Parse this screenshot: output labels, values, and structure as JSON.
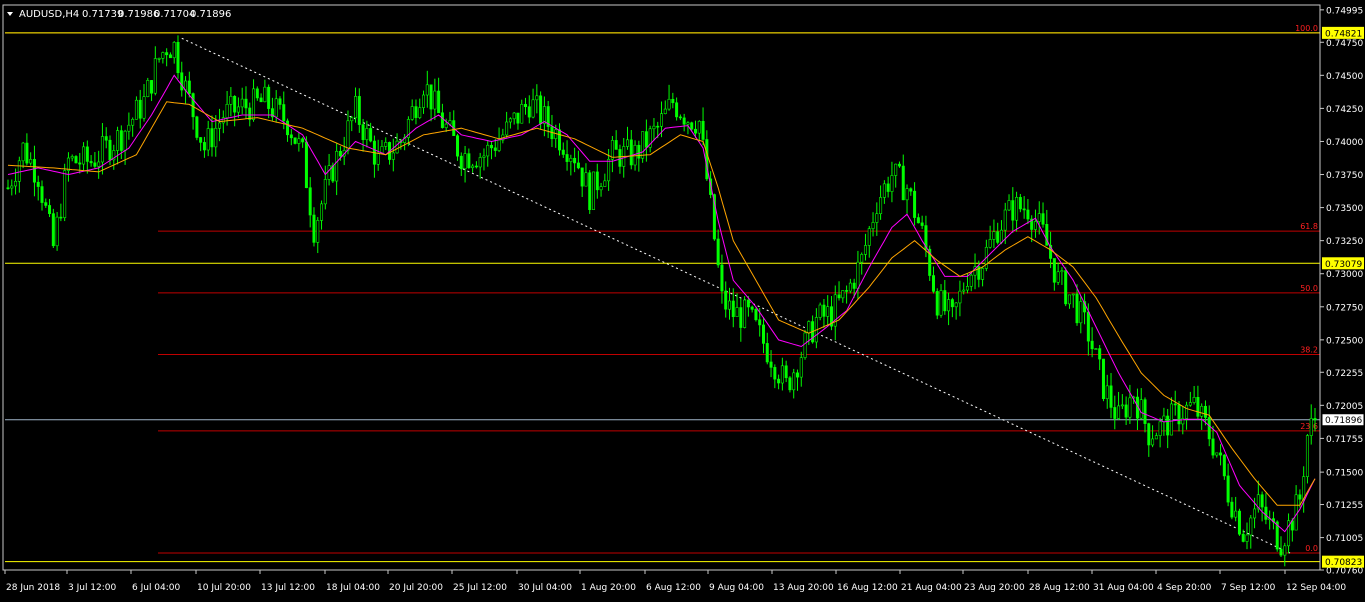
{
  "header": {
    "symbol": "AUDUSD,H4",
    "open": "0.71739",
    "high": "0.71986",
    "low": "0.71704",
    "close": "0.71896"
  },
  "colors": {
    "background": "#000000",
    "candle": "#00ff00",
    "ma_fast": "#ff00ff",
    "ma_slow": "#ffa500",
    "fib": "#c00000",
    "trendline": "#ffffff",
    "hline": "#ffff00",
    "bid_line": "#a0b4c8",
    "axis_text": "#ffffff"
  },
  "chart_data": {
    "type": "candlestick",
    "title": "AUDUSD,H4",
    "xlabel": "",
    "ylabel": "",
    "ylim": [
      0.7076,
      0.75009
    ],
    "grid": false,
    "y_ticks": [
      "0.74995",
      "0.74750",
      "0.74500",
      "0.74250",
      "0.74000",
      "0.73750",
      "0.73500",
      "0.73250",
      "0.73000",
      "0.72750",
      "0.72500",
      "0.72255",
      "0.72005",
      "0.71755",
      "0.71500",
      "0.71255",
      "0.71005",
      "0.70760"
    ],
    "x_ticks": [
      "28 Jun 2018",
      "3 Jul 12:00",
      "6 Jul 04:00",
      "10 Jul 20:00",
      "13 Jul 12:00",
      "18 Jul 04:00",
      "20 Jul 20:00",
      "25 Jul 12:00",
      "30 Jul 04:00",
      "1 Aug 20:00",
      "6 Aug 12:00",
      "9 Aug 04:00",
      "13 Aug 20:00",
      "16 Aug 12:00",
      "21 Aug 04:00",
      "23 Aug 20:00",
      "28 Aug 12:00",
      "31 Aug 04:00",
      "4 Sep 20:00",
      "7 Sep 12:00",
      "12 Sep 04:00"
    ],
    "price_path": [
      [
        0,
        0.7365
      ],
      [
        4,
        0.7395
      ],
      [
        8,
        0.7375
      ],
      [
        12,
        0.732
      ],
      [
        16,
        0.7385
      ],
      [
        22,
        0.7385
      ],
      [
        30,
        0.7405
      ],
      [
        36,
        0.743
      ],
      [
        40,
        0.7463
      ],
      [
        42,
        0.7472
      ],
      [
        44,
        0.7472
      ],
      [
        47,
        0.744
      ],
      [
        52,
        0.7395
      ],
      [
        57,
        0.742
      ],
      [
        62,
        0.7426
      ],
      [
        68,
        0.743
      ],
      [
        74,
        0.7415
      ],
      [
        78,
        0.739
      ],
      [
        81,
        0.7335
      ],
      [
        86,
        0.738
      ],
      [
        92,
        0.7423
      ],
      [
        98,
        0.7385
      ],
      [
        104,
        0.74
      ],
      [
        110,
        0.7445
      ],
      [
        114,
        0.742
      ],
      [
        120,
        0.739
      ],
      [
        126,
        0.739
      ],
      [
        132,
        0.7408
      ],
      [
        138,
        0.743
      ],
      [
        144,
        0.741
      ],
      [
        150,
        0.739
      ],
      [
        154,
        0.736
      ],
      [
        160,
        0.739
      ],
      [
        166,
        0.739
      ],
      [
        172,
        0.741
      ],
      [
        176,
        0.743
      ],
      [
        180,
        0.7418
      ],
      [
        183,
        0.7415
      ],
      [
        186,
        0.735
      ],
      [
        189,
        0.728
      ],
      [
        192,
        0.727
      ],
      [
        196,
        0.7268
      ],
      [
        202,
        0.7238
      ],
      [
        206,
        0.7215
      ],
      [
        210,
        0.724
      ],
      [
        214,
        0.7265
      ],
      [
        218,
        0.727
      ],
      [
        222,
        0.7285
      ],
      [
        226,
        0.731
      ],
      [
        230,
        0.7355
      ],
      [
        234,
        0.7375
      ],
      [
        238,
        0.7365
      ],
      [
        242,
        0.733
      ],
      [
        246,
        0.728
      ],
      [
        250,
        0.7265
      ],
      [
        254,
        0.73
      ],
      [
        258,
        0.731
      ],
      [
        262,
        0.7335
      ],
      [
        266,
        0.735
      ],
      [
        270,
        0.735
      ],
      [
        274,
        0.733
      ],
      [
        278,
        0.7295
      ],
      [
        282,
        0.728
      ],
      [
        286,
        0.7255
      ],
      [
        290,
        0.7215
      ],
      [
        294,
        0.719
      ],
      [
        298,
        0.721
      ],
      [
        302,
        0.718
      ],
      [
        306,
        0.7185
      ],
      [
        310,
        0.7195
      ],
      [
        314,
        0.72
      ],
      [
        317,
        0.7185
      ],
      [
        320,
        0.7165
      ],
      [
        323,
        0.7135
      ],
      [
        327,
        0.7105
      ],
      [
        331,
        0.7125
      ],
      [
        334,
        0.711
      ],
      [
        337,
        0.7098
      ],
      [
        340,
        0.7115
      ],
      [
        342,
        0.713
      ],
      [
        344,
        0.7178
      ],
      [
        346,
        0.719
      ]
    ],
    "series": [
      {
        "role": "ma_fast",
        "values": [
          [
            0,
            0.7375
          ],
          [
            8,
            0.738
          ],
          [
            16,
            0.7375
          ],
          [
            24,
            0.738
          ],
          [
            32,
            0.7395
          ],
          [
            38,
            0.742
          ],
          [
            44,
            0.745
          ],
          [
            48,
            0.7435
          ],
          [
            54,
            0.7415
          ],
          [
            62,
            0.742
          ],
          [
            70,
            0.742
          ],
          [
            78,
            0.7405
          ],
          [
            84,
            0.7375
          ],
          [
            92,
            0.74
          ],
          [
            100,
            0.739
          ],
          [
            108,
            0.741
          ],
          [
            114,
            0.742
          ],
          [
            120,
            0.7405
          ],
          [
            128,
            0.74
          ],
          [
            136,
            0.7405
          ],
          [
            142,
            0.7415
          ],
          [
            148,
            0.7405
          ],
          [
            154,
            0.7385
          ],
          [
            160,
            0.7385
          ],
          [
            168,
            0.7392
          ],
          [
            174,
            0.741
          ],
          [
            180,
            0.7412
          ],
          [
            184,
            0.7395
          ],
          [
            188,
            0.734
          ],
          [
            192,
            0.7295
          ],
          [
            198,
            0.7275
          ],
          [
            204,
            0.725
          ],
          [
            210,
            0.7245
          ],
          [
            216,
            0.7258
          ],
          [
            222,
            0.7272
          ],
          [
            228,
            0.7305
          ],
          [
            234,
            0.7335
          ],
          [
            238,
            0.7345
          ],
          [
            242,
            0.7325
          ],
          [
            248,
            0.7298
          ],
          [
            254,
            0.7298
          ],
          [
            260,
            0.7315
          ],
          [
            266,
            0.7332
          ],
          [
            272,
            0.7342
          ],
          [
            276,
            0.732
          ],
          [
            282,
            0.7295
          ],
          [
            288,
            0.726
          ],
          [
            294,
            0.7225
          ],
          [
            300,
            0.7195
          ],
          [
            306,
            0.7188
          ],
          [
            312,
            0.719
          ],
          [
            316,
            0.719
          ],
          [
            320,
            0.718
          ],
          [
            326,
            0.714
          ],
          [
            332,
            0.712
          ],
          [
            338,
            0.7105
          ],
          [
            342,
            0.7122
          ],
          [
            346,
            0.7145
          ]
        ]
      },
      {
        "role": "ma_slow",
        "values": [
          [
            0,
            0.7382
          ],
          [
            12,
            0.738
          ],
          [
            24,
            0.7377
          ],
          [
            34,
            0.739
          ],
          [
            42,
            0.743
          ],
          [
            48,
            0.7428
          ],
          [
            56,
            0.7415
          ],
          [
            66,
            0.7418
          ],
          [
            78,
            0.741
          ],
          [
            90,
            0.7395
          ],
          [
            100,
            0.739
          ],
          [
            110,
            0.7405
          ],
          [
            120,
            0.741
          ],
          [
            130,
            0.7402
          ],
          [
            140,
            0.741
          ],
          [
            150,
            0.7402
          ],
          [
            160,
            0.7388
          ],
          [
            170,
            0.739
          ],
          [
            178,
            0.7405
          ],
          [
            184,
            0.74
          ],
          [
            188,
            0.7365
          ],
          [
            192,
            0.7325
          ],
          [
            198,
            0.7295
          ],
          [
            204,
            0.7265
          ],
          [
            212,
            0.7255
          ],
          [
            220,
            0.7265
          ],
          [
            228,
            0.729
          ],
          [
            234,
            0.7312
          ],
          [
            240,
            0.7325
          ],
          [
            246,
            0.731
          ],
          [
            252,
            0.7298
          ],
          [
            258,
            0.7305
          ],
          [
            264,
            0.7318
          ],
          [
            270,
            0.7328
          ],
          [
            276,
            0.7318
          ],
          [
            282,
            0.7305
          ],
          [
            288,
            0.7282
          ],
          [
            294,
            0.7253
          ],
          [
            300,
            0.7225
          ],
          [
            306,
            0.7208
          ],
          [
            312,
            0.7198
          ],
          [
            318,
            0.7193
          ],
          [
            324,
            0.7168
          ],
          [
            330,
            0.7145
          ],
          [
            336,
            0.7125
          ],
          [
            342,
            0.7125
          ],
          [
            346,
            0.7145
          ]
        ]
      }
    ],
    "fibonacci": [
      {
        "level": "100.0",
        "price": 0.74821
      },
      {
        "level": "61.8",
        "price": 0.73322
      },
      {
        "level": "50.0",
        "price": 0.72855
      },
      {
        "level": "38.2",
        "price": 0.72389
      },
      {
        "level": "23.6",
        "price": 0.71812
      },
      {
        "level": "0.0",
        "price": 0.70889
      }
    ],
    "horizontal_lines": [
      {
        "label": "0.74821",
        "price": 0.74821,
        "tag": "yellow"
      },
      {
        "label": "0.73079",
        "price": 0.73079,
        "tag": "yellow"
      },
      {
        "label": "0.71896",
        "price": 0.71896,
        "tag": "bid"
      },
      {
        "label": "0.70823",
        "price": 0.70823,
        "tag": "yellow"
      }
    ]
  }
}
